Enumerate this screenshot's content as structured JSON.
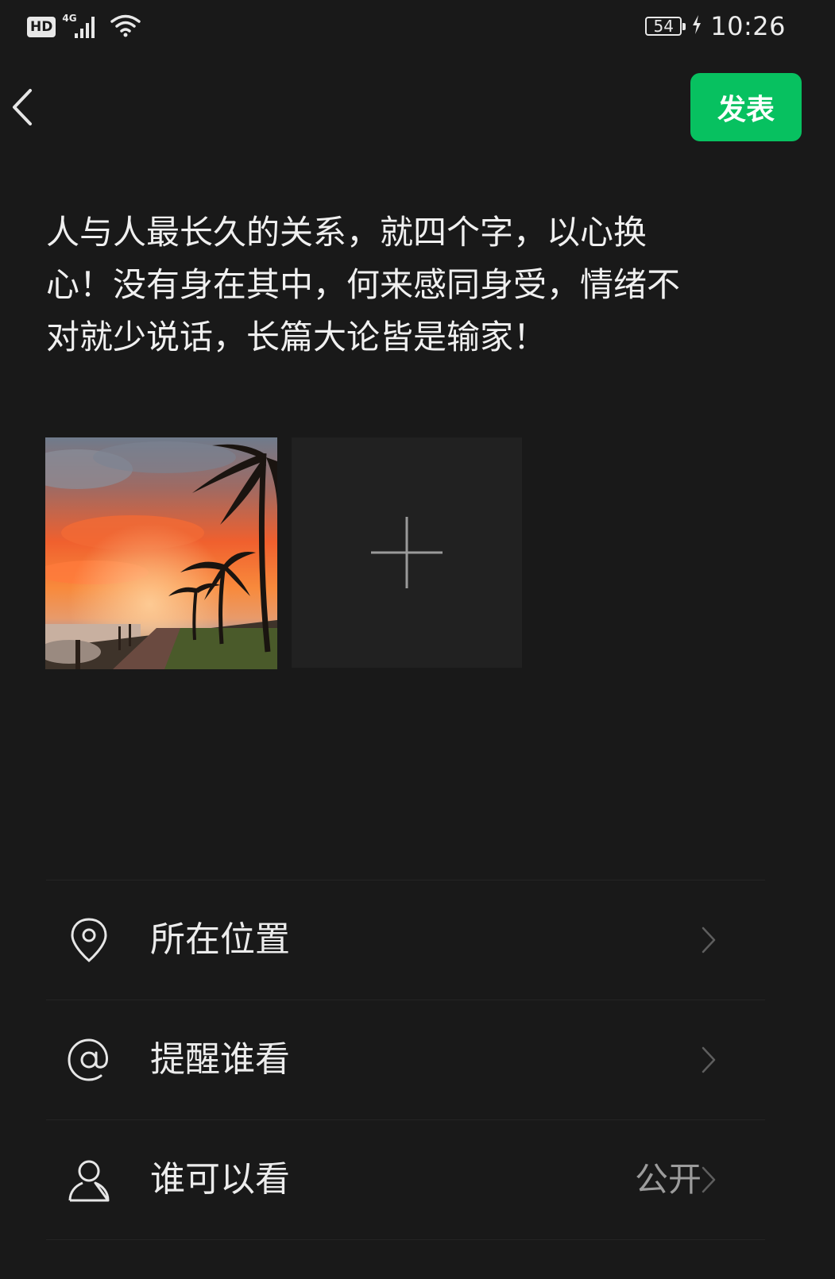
{
  "status_bar": {
    "hd_label": "HD",
    "network_label": "4G",
    "battery": "54",
    "time": "10:26"
  },
  "header": {
    "back_icon": "chevron-left-icon",
    "post_label": "发表",
    "post_color": "#07c160"
  },
  "compose": {
    "text": "人与人最长久的关系，就四个字，以心换\n心！没有身在其中，何来感同身受，情绪不\n对就少说话，长篇大论皆是输家！"
  },
  "photos": {
    "items": [
      {
        "description_icon": "sunset-palm-photo"
      }
    ],
    "add_icon": "plus-icon"
  },
  "options": [
    {
      "icon": "location-pin-icon",
      "label": "所在位置",
      "value": ""
    },
    {
      "icon": "at-sign-icon",
      "label": "提醒谁看",
      "value": ""
    },
    {
      "icon": "person-icon",
      "label": "谁可以看",
      "value": "公开"
    }
  ],
  "colors": {
    "background": "#191919",
    "accent": "#07c160",
    "secondary_text": "#9c9c9c"
  }
}
